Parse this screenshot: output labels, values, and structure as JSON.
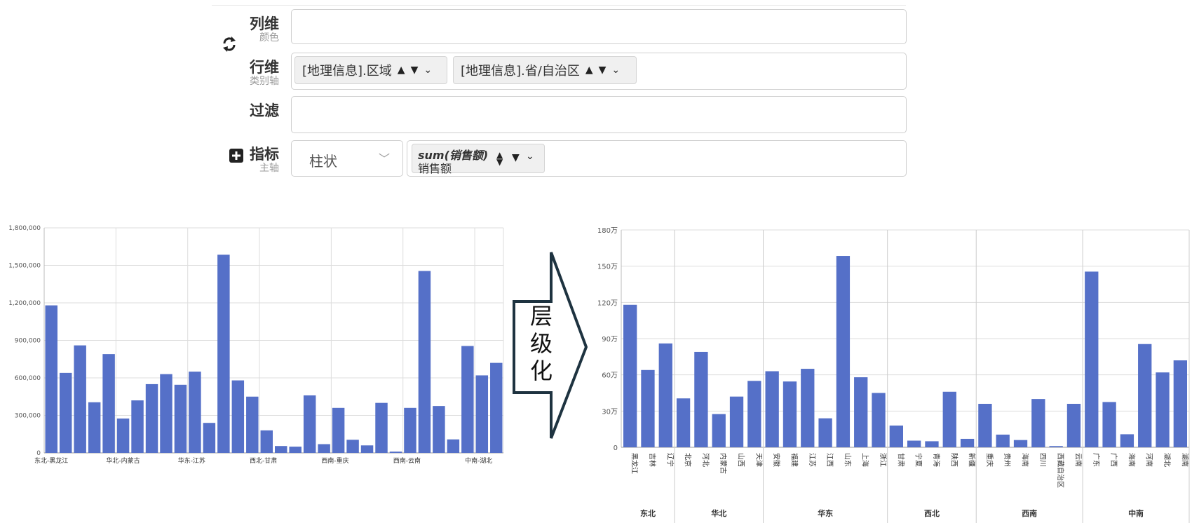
{
  "config": {
    "rows": [
      {
        "label": "列维",
        "sub": "颜色"
      },
      {
        "label": "行维",
        "sub": "类别轴"
      },
      {
        "label": "过滤",
        "sub": ""
      },
      {
        "label": "指标",
        "sub": "主轴"
      }
    ],
    "row_chips": [
      {
        "text": "[地理信息].区域"
      },
      {
        "text": "[地理信息].省/自治区"
      }
    ],
    "chart_type_select": "柱状",
    "measure_chip": {
      "line1": "sum(销售额)",
      "line2": "销售额"
    }
  },
  "arrow_text": [
    "层",
    "级",
    "化"
  ],
  "chart_data": [
    {
      "type": "bar",
      "title": "",
      "ylim": [
        0,
        1800000
      ],
      "yticks": [
        "0",
        "300,000",
        "600,000",
        "900,000",
        "1,200,000",
        "1,500,000",
        "1,800,000"
      ],
      "xtick_labels": [
        "东北-黑龙江",
        "华北-内蒙古",
        "华东-江苏",
        "西北-甘肃",
        "西南-重庆",
        "西南-云南",
        "中南-湖北"
      ],
      "values": [
        1180000,
        640000,
        860000,
        405000,
        790000,
        275000,
        420000,
        550000,
        630000,
        545000,
        650000,
        240000,
        1585000,
        580000,
        450000,
        180000,
        55000,
        50000,
        460000,
        70000,
        360000,
        105000,
        60000,
        400000,
        10000,
        360000,
        1455000,
        375000,
        108000,
        855000,
        620000,
        720000
      ],
      "color": "#5570c8",
      "grid": true
    },
    {
      "type": "bar",
      "title": "",
      "ylim": [
        0,
        1800000
      ],
      "yticks": [
        "0",
        "30万",
        "60万",
        "90万",
        "120万",
        "150万",
        "180万"
      ],
      "series": [
        {
          "name": "销售额"
        }
      ],
      "groups": [
        {
          "name": "东北",
          "categories": [
            "黑龙江",
            "吉林",
            "辽宁"
          ],
          "values": [
            1180000,
            640000,
            860000
          ]
        },
        {
          "name": "华北",
          "categories": [
            "北京",
            "河北",
            "内蒙古",
            "山西",
            "天津"
          ],
          "values": [
            405000,
            790000,
            275000,
            420000,
            550000
          ]
        },
        {
          "name": "华东",
          "categories": [
            "安徽",
            "福建",
            "江苏",
            "江西",
            "山东",
            "上海",
            "浙江"
          ],
          "values": [
            630000,
            545000,
            650000,
            240000,
            1585000,
            580000,
            450000
          ]
        },
        {
          "name": "西北",
          "categories": [
            "甘肃",
            "宁夏",
            "青海",
            "陕西",
            "新疆"
          ],
          "values": [
            180000,
            55000,
            50000,
            460000,
            70000
          ]
        },
        {
          "name": "西南",
          "categories": [
            "重庆",
            "贵州",
            "海南",
            "四川",
            "西藏自治区",
            "云南"
          ],
          "values": [
            360000,
            105000,
            60000,
            400000,
            10000,
            360000
          ]
        },
        {
          "name": "中南",
          "categories": [
            "广东",
            "广西",
            "海南",
            "河南",
            "湖北",
            "湖南"
          ],
          "values": [
            1455000,
            375000,
            108000,
            855000,
            620000,
            720000
          ]
        }
      ],
      "color": "#5570c8",
      "grid": true
    }
  ]
}
